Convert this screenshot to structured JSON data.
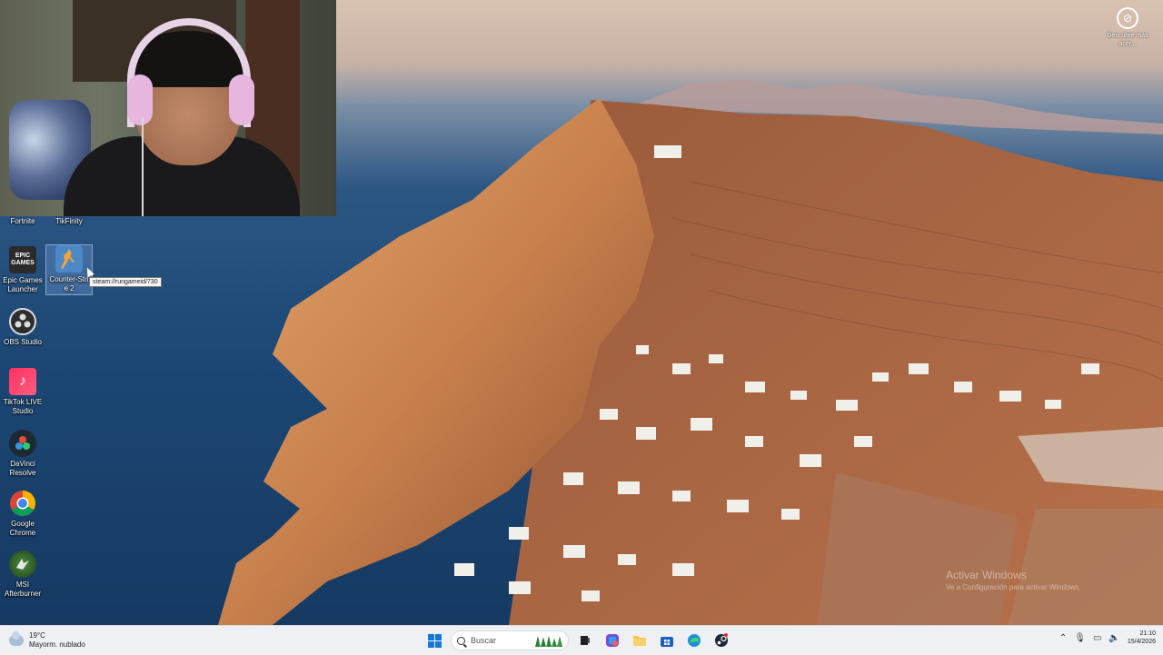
{
  "desktop": {
    "top_labels": [
      "Fortnite",
      "TikFinity"
    ],
    "icons": [
      {
        "label": "Epic Games Launcher",
        "icon": "epic-games-icon"
      },
      {
        "label": "Counter-Strike 2",
        "icon": "counter-strike-icon",
        "display": "Counter-Stri\ne 2"
      },
      {
        "label": "OBS Studio",
        "icon": "obs-icon"
      },
      {
        "label": "TikTok LIVE Studio",
        "icon": "tiktok-live-icon"
      },
      {
        "label": "DaVinci Resolve",
        "icon": "davinci-icon"
      },
      {
        "label": "Google Chrome",
        "icon": "chrome-icon"
      },
      {
        "label": "MSI Afterburner",
        "icon": "msi-afterburner-icon"
      }
    ],
    "tooltip": "steam://rungameid/730"
  },
  "spotlight": {
    "label": "Descubre más acer..."
  },
  "watermark": {
    "title": "Activar Windows",
    "subtitle": "Ve a Configuración para activar Windows."
  },
  "taskbar": {
    "weather": {
      "temp": "19°C",
      "condition": "Mayorm. nublado"
    },
    "search_placeholder": "Buscar",
    "apps": [
      "task-view-icon",
      "copilot-icon",
      "file-explorer-icon",
      "microsoft-store-icon",
      "edge-icon",
      "steam-icon"
    ],
    "clock": {
      "time": "21:10",
      "date": "15/4/2026"
    }
  },
  "colors": {
    "taskbar_bg": "#eef0f4",
    "accent": "#1677d8"
  }
}
